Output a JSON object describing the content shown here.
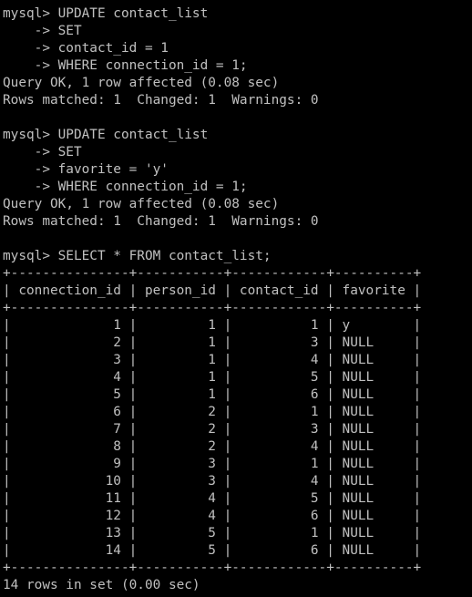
{
  "terminal": {
    "background": "#000000",
    "foreground": "#c0c0c0",
    "lines": [
      "mysql> UPDATE contact_list",
      "    -> SET",
      "    -> contact_id = 1",
      "    -> WHERE connection_id = 1;",
      "Query OK, 1 row affected (0.08 sec)",
      "Rows matched: 1  Changed: 1  Warnings: 0",
      "",
      "mysql> UPDATE contact_list",
      "    -> SET",
      "    -> favorite = 'y'",
      "    -> WHERE connection_id = 1;",
      "Query OK, 1 row affected (0.08 sec)",
      "Rows matched: 1  Changed: 1  Warnings: 0",
      "",
      "mysql> SELECT * FROM contact_list;",
      "+---------------+-----------+------------+----------+",
      "| connection_id | person_id | contact_id | favorite |",
      "+---------------+-----------+------------+----------+",
      "|             1 |         1 |          1 | y        |",
      "|             2 |         1 |          3 | NULL     |",
      "|             3 |         1 |          4 | NULL     |",
      "|             4 |         1 |          5 | NULL     |",
      "|             5 |         1 |          6 | NULL     |",
      "|             6 |         2 |          1 | NULL     |",
      "|             7 |         2 |          3 | NULL     |",
      "|             8 |         2 |          4 | NULL     |",
      "|             9 |         3 |          1 | NULL     |",
      "|            10 |         3 |          4 | NULL     |",
      "|            11 |         4 |          5 | NULL     |",
      "|            12 |         4 |          6 | NULL     |",
      "|            13 |         5 |          1 | NULL     |",
      "|            14 |         5 |          6 | NULL     |",
      "+---------------+-----------+------------+----------+",
      "14 rows in set (0.00 sec)"
    ]
  }
}
